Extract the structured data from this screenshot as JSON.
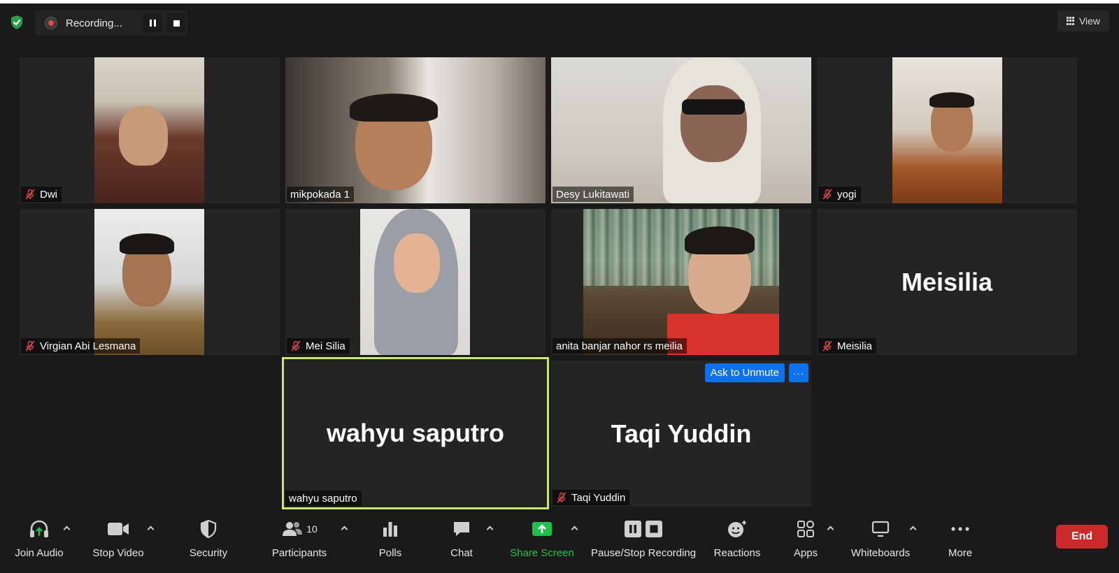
{
  "recording": {
    "status": "Recording..."
  },
  "view": {
    "label": "View"
  },
  "tiles": [
    {
      "name": "Dwi",
      "muted": true,
      "type": "video"
    },
    {
      "name": "mikpokada 1",
      "muted": false,
      "type": "video"
    },
    {
      "name": "Desy Lukitawati",
      "muted": false,
      "type": "video"
    },
    {
      "name": "yogi",
      "muted": true,
      "type": "video"
    },
    {
      "name": "Virgian Abi Lesmana",
      "muted": true,
      "type": "video"
    },
    {
      "name": "Mei Silia",
      "muted": true,
      "type": "video"
    },
    {
      "name": "anita banjar nahor rs meilia",
      "muted": false,
      "type": "video"
    },
    {
      "name": "Meisilia",
      "muted": true,
      "type": "name",
      "display_name": "Meisilia"
    },
    {
      "name": "wahyu saputro",
      "muted": false,
      "type": "name",
      "display_name": "wahyu saputro",
      "active_speaker": true
    },
    {
      "name": "Taqi Yuddin",
      "muted": true,
      "type": "name",
      "display_name": "Taqi Yuddin"
    }
  ],
  "tile_actions": {
    "ask_to_unmute": "Ask to Unmute",
    "more": "···"
  },
  "toolbar": {
    "join_audio": "Join Audio",
    "stop_video": "Stop Video",
    "security": "Security",
    "participants": "Participants",
    "participants_count": "10",
    "polls": "Polls",
    "chat": "Chat",
    "share_screen": "Share Screen",
    "pause_stop_recording": "Pause/Stop Recording",
    "reactions": "Reactions",
    "apps": "Apps",
    "whiteboards": "Whiteboards",
    "more": "More",
    "end": "End"
  },
  "colors": {
    "background": "#1a1a1a",
    "tile": "#242424",
    "accent_blue": "#0e71eb",
    "share_green": "#20c14a",
    "end_red": "#cc2a2a",
    "active_speaker_border": "#c8e670",
    "muted_red": "#e0474c"
  }
}
